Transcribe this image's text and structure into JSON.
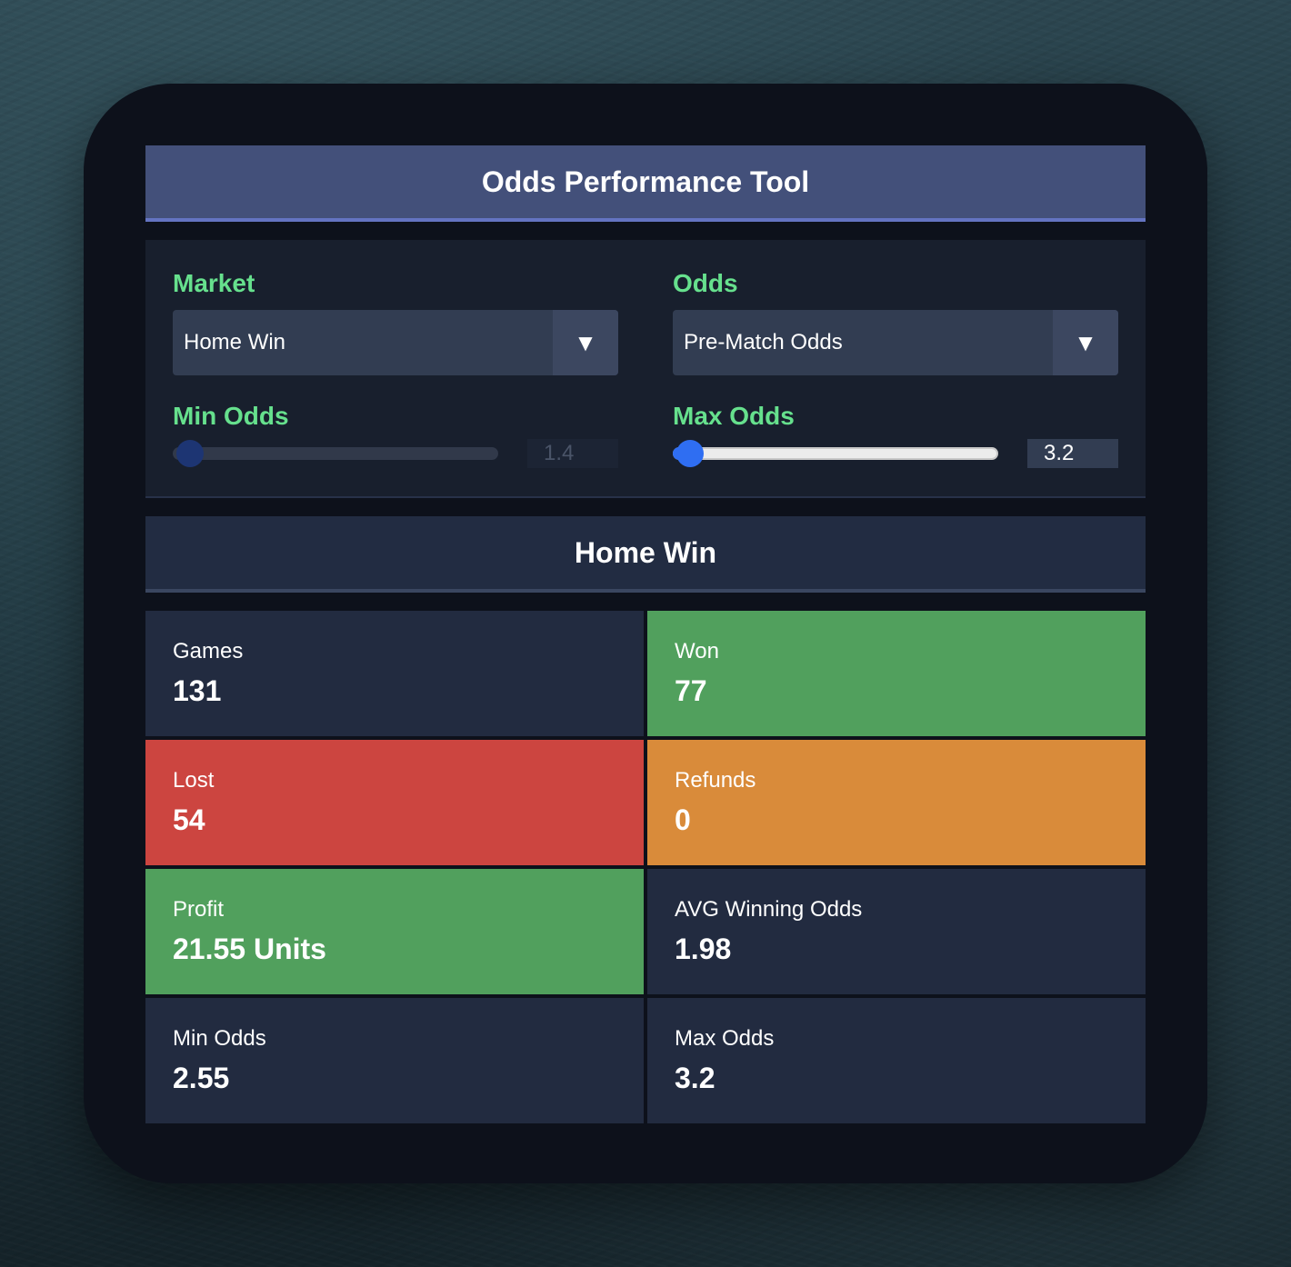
{
  "header": {
    "title": "Odds Performance Tool"
  },
  "filters": {
    "market": {
      "label": "Market",
      "value": "Home Win"
    },
    "odds": {
      "label": "Odds",
      "value": "Pre-Match Odds"
    },
    "min_odds": {
      "label": "Min Odds",
      "value": "1.4",
      "fraction": 0.0
    },
    "max_odds": {
      "label": "Max Odds",
      "value": "3.2",
      "fraction": 0.0
    }
  },
  "results": {
    "title": "Home Win",
    "stats": [
      {
        "label": "Games",
        "value": "131",
        "color": "#222b40"
      },
      {
        "label": "Won",
        "value": "77",
        "color": "#51a05d"
      },
      {
        "label": "Lost",
        "value": "54",
        "color": "#cc4540"
      },
      {
        "label": "Refunds",
        "value": "0",
        "color": "#d98b3a"
      },
      {
        "label": "Profit",
        "value": "21.55 Units",
        "color": "#51a05d"
      },
      {
        "label": "AVG Winning Odds",
        "value": "1.98",
        "color": "#222b40"
      },
      {
        "label": "Min Odds",
        "value": "2.55",
        "color": "#222b40"
      },
      {
        "label": "Max Odds",
        "value": "3.2",
        "color": "#222b40"
      }
    ]
  },
  "colors": {
    "accent_green_label": "#66e08d",
    "slider_active": "#2f6ef2",
    "slider_disabled_thumb": "#1d3573"
  },
  "icons": {
    "dropdown": "triangle-down-icon"
  }
}
